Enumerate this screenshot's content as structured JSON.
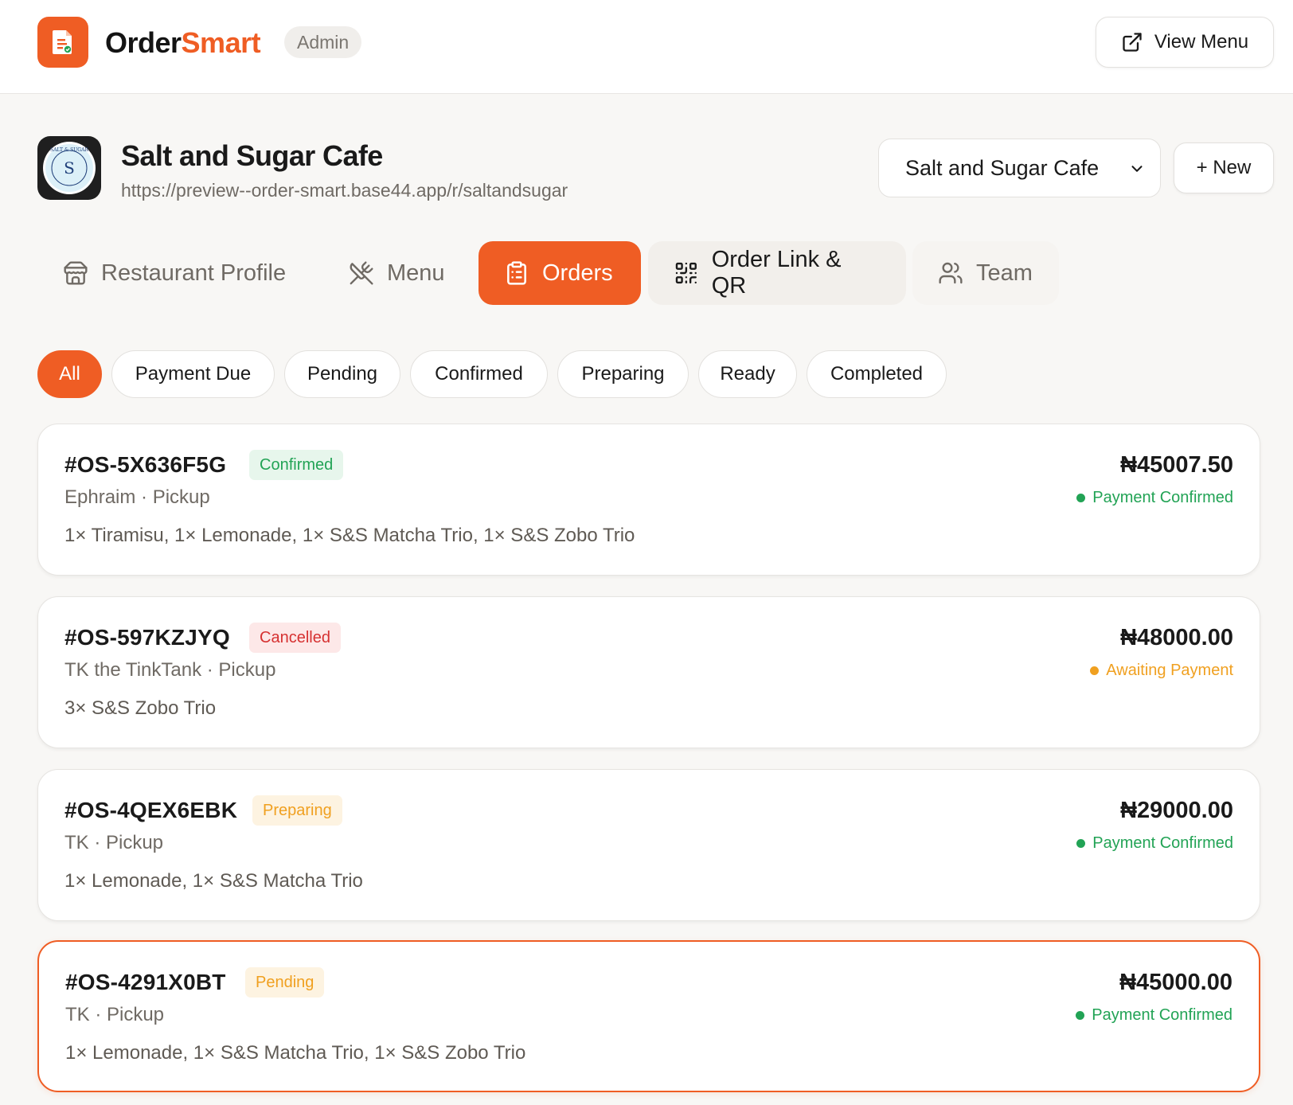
{
  "header": {
    "brand_part1": "Order",
    "brand_part2": "Smart",
    "role_badge": "Admin",
    "view_menu_label": "View Menu"
  },
  "restaurant": {
    "name": "Salt and Sugar Cafe",
    "url": "https://preview--order-smart.base44.app/r/saltandsugar",
    "selected": "Salt and Sugar Cafe",
    "new_label": "+ New",
    "logo_text": "SALT & SUGAR"
  },
  "tabs": [
    {
      "label": "Restaurant Profile",
      "icon": "store-icon"
    },
    {
      "label": "Menu",
      "icon": "utensils-crossed-icon"
    },
    {
      "label": "Orders",
      "icon": "clipboard-icon",
      "active": true
    },
    {
      "label": "Order Link & QR",
      "icon": "qr-code-icon"
    },
    {
      "label": "Team",
      "icon": "users-icon"
    }
  ],
  "filters": [
    "All",
    "Payment Due",
    "Pending",
    "Confirmed",
    "Preparing",
    "Ready",
    "Completed"
  ],
  "active_filter": "All",
  "orders": [
    {
      "id": "#OS-5X636F5G",
      "status": "Confirmed",
      "customer": "Ephraim · Pickup",
      "items": "1× Tiramisu, 1× Lemonade, 1× S&S Matcha Trio, 1× S&S Zobo Trio",
      "total": "₦45007.50",
      "payment": "Payment Confirmed"
    },
    {
      "id": "#OS-597KZJYQ",
      "status": "Cancelled",
      "customer": "TK the TinkTank · Pickup",
      "items": "3× S&S Zobo Trio",
      "total": "₦48000.00",
      "payment": "Awaiting Payment"
    },
    {
      "id": "#OS-4QEX6EBK",
      "status": "Preparing",
      "customer": "TK · Pickup",
      "items": "1× Lemonade, 1× S&S Matcha Trio",
      "total": "₦29000.00",
      "payment": "Payment Confirmed"
    },
    {
      "id": "#OS-4291X0BT",
      "status": "Pending",
      "customer": "TK · Pickup",
      "items": "1× Lemonade, 1× S&S Matcha Trio, 1× S&S Zobo Trio",
      "total": "₦45000.00",
      "payment": "Payment Confirmed"
    }
  ],
  "colors": {
    "accent": "#ef5d24",
    "confirmed": "#22a355",
    "cancelled": "#d63131",
    "warning": "#f0a020"
  }
}
